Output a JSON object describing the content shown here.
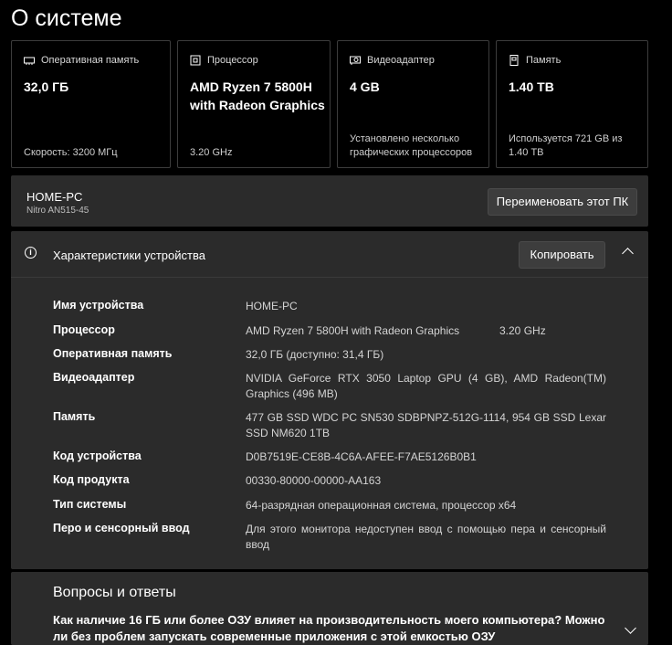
{
  "page": {
    "title": "О системе"
  },
  "cards": [
    {
      "icon": "ram-icon",
      "label": "Оперативная память",
      "value": "32,0 ГБ",
      "foot": "Скорость: 3200 МГц"
    },
    {
      "icon": "cpu-icon",
      "label": "Процессор",
      "value": "AMD Ryzen 7 5800H with Radeon Graphics",
      "foot": "3.20 GHz"
    },
    {
      "icon": "gpu-icon",
      "label": "Видеоадаптер",
      "value": "4 GB",
      "foot": "Установлено несколько графических процессоров"
    },
    {
      "icon": "storage-icon",
      "label": "Память",
      "value": "1.40 TB",
      "foot": "Используется 721 GB из 1.40 TB"
    }
  ],
  "pc": {
    "name": "HOME-PC",
    "model": "Nitro AN515-45",
    "rename_label": "Переименовать этот ПК"
  },
  "specs": {
    "title": "Характеристики устройства",
    "copy_label": "Копировать",
    "rows": [
      {
        "key": "Имя устройства",
        "value": "HOME-PC"
      },
      {
        "key": "Процессор",
        "value": "AMD Ryzen 7 5800H with Radeon Graphics",
        "extra": "3.20 GHz"
      },
      {
        "key": "Оперативная память",
        "value": "32,0 ГБ (доступно: 31,4 ГБ)"
      },
      {
        "key": "Видеоадаптер",
        "value": "NVIDIA GeForce RTX 3050 Laptop GPU (4 GB), AMD Radeon(TM) Graphics (496 MB)"
      },
      {
        "key": "Память",
        "value": "477 GB SSD WDC PC SN530 SDBPNPZ-512G-1114, 954 GB SSD Lexar SSD NM620 1TB"
      },
      {
        "key": "Код устройства",
        "value": "D0B7519E-CE8B-4C6A-AFEE-F7AE5126B0B1"
      },
      {
        "key": "Код продукта",
        "value": "00330-80000-00000-AA163"
      },
      {
        "key": "Тип системы",
        "value": "64-разрядная операционная система, процессор x64"
      },
      {
        "key": "Перо и сенсорный ввод",
        "value": "Для этого монитора недоступен ввод с помощью пера и сенсорный ввод"
      }
    ]
  },
  "faq": {
    "title": "Вопросы и ответы",
    "question": "Как наличие 16 ГБ или более ОЗУ влияет на производительность моего компьютера? Можно ли без проблем запускать современные приложения с этой емкостью ОЗУ"
  }
}
